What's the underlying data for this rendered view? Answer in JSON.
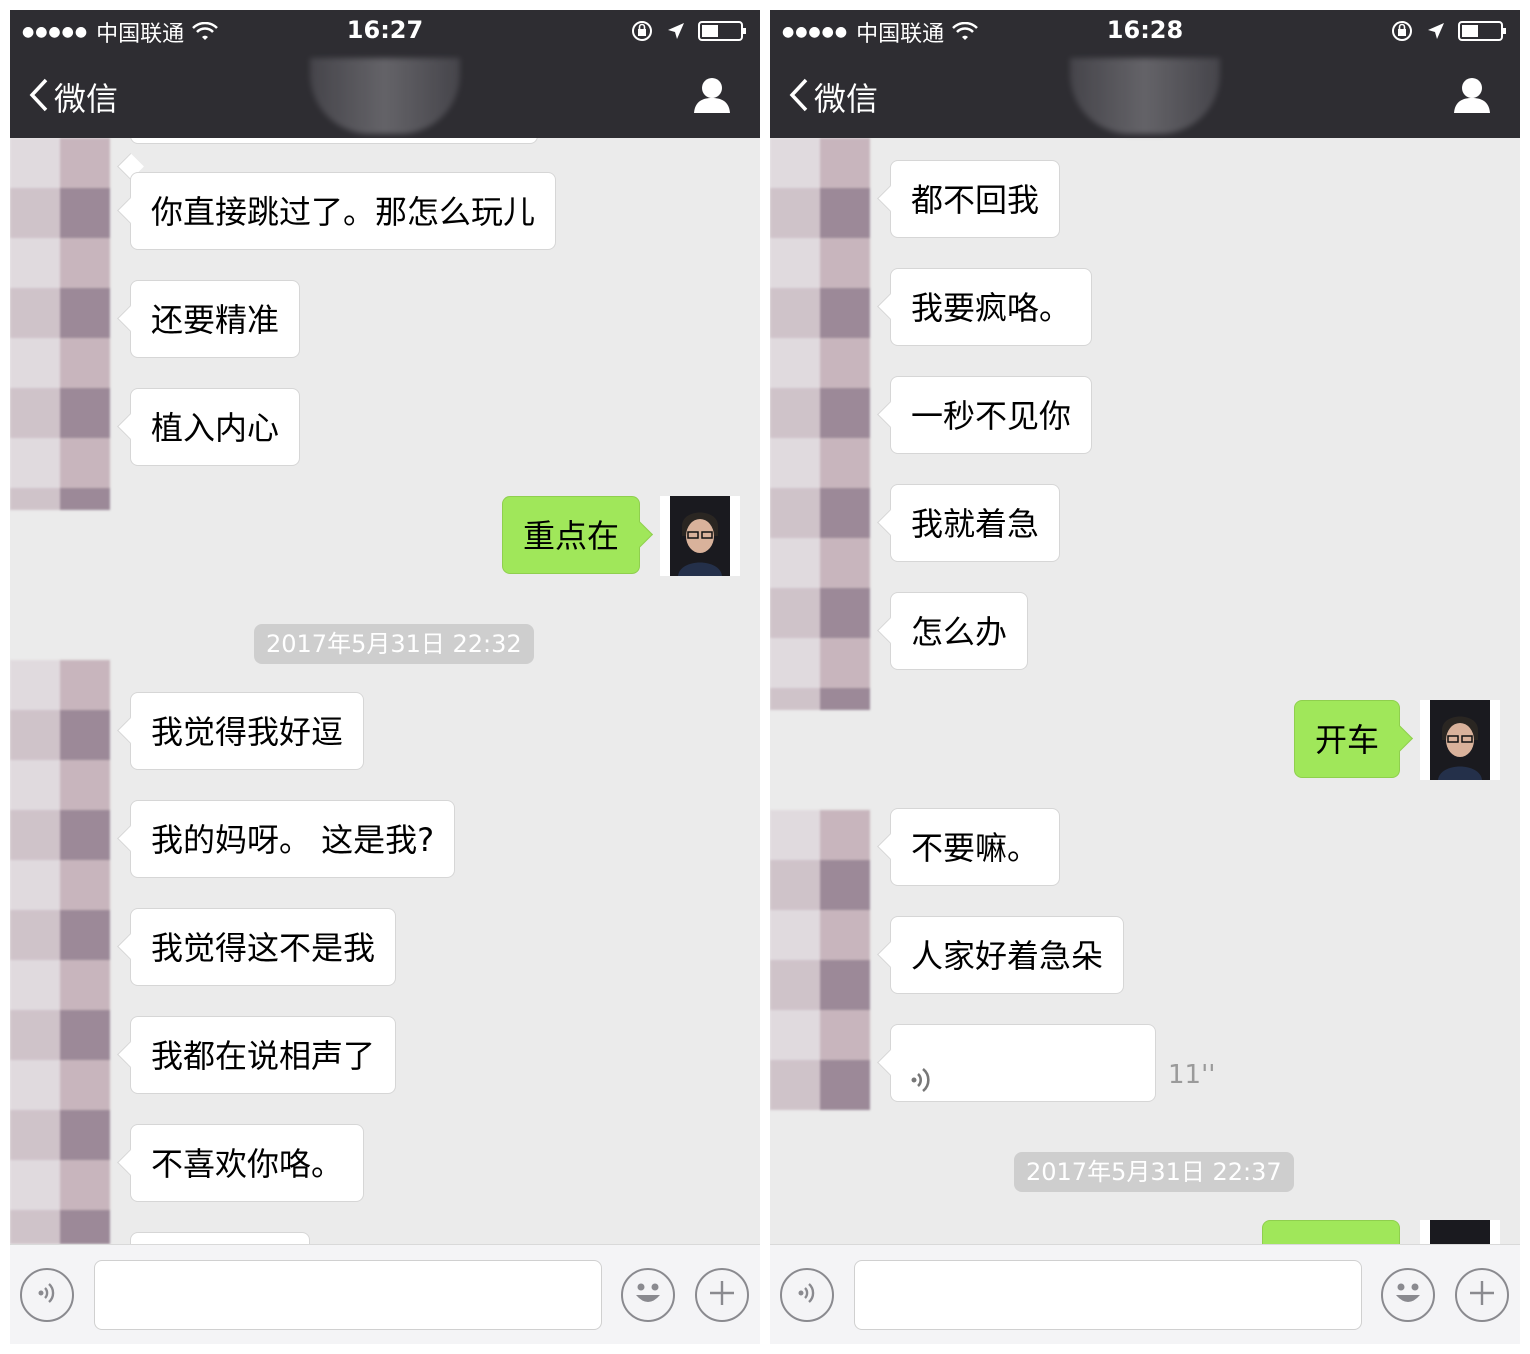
{
  "panels": [
    {
      "status": {
        "carrier": "中国联通",
        "time": "16:27"
      },
      "nav": {
        "back_label": "微信"
      },
      "timestamp": "2017年5月31日 22:32",
      "messages_before": [
        "你直接跳过了。那怎么玩儿",
        "还要精准",
        "植入内心"
      ],
      "sent": "重点在",
      "messages_after": [
        "我觉得我好逗",
        "我的妈呀。 这是我?",
        "我觉得这不是我",
        "我都在说相声了",
        "不喜欢你咯。"
      ]
    },
    {
      "status": {
        "carrier": "中国联通",
        "time": "16:28"
      },
      "nav": {
        "back_label": "微信"
      },
      "messages_before": [
        "都不回我",
        "我要疯咯。",
        "一秒不见你",
        "我就着急",
        "怎么办"
      ],
      "sent": "开车",
      "messages_after": [
        "不要嘛。",
        "人家好着急朵"
      ],
      "voice_duration": "11''",
      "timestamp": "2017年5月31日 22:37"
    }
  ],
  "icons": {
    "back": "chevron-left-icon",
    "profile": "person-icon",
    "voice": "voice-icon",
    "emoji": "smiley-icon",
    "plus": "plus-icon",
    "wifi": "wifi-icon",
    "lock_rotation": "rotation-lock-icon",
    "location": "location-arrow-icon",
    "battery": "battery-icon"
  },
  "colors": {
    "nav_bg": "#2e2d32",
    "chat_bg": "#ebebeb",
    "sent_bubble": "#a0e75a",
    "received_bubble": "#ffffff",
    "timestamp_bg": "#cecece"
  }
}
